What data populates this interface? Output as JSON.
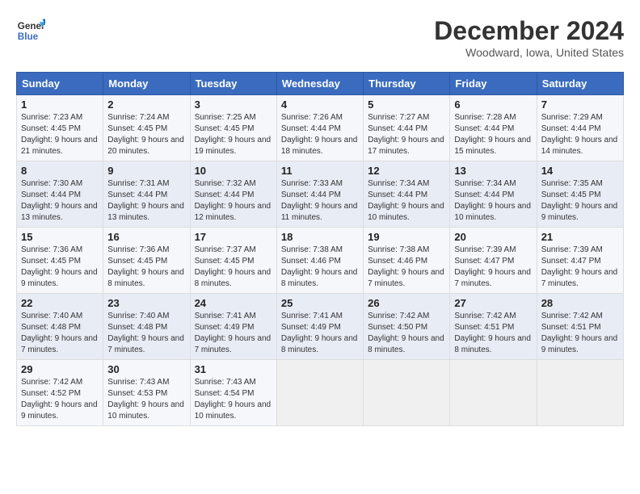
{
  "header": {
    "logo_line1": "General",
    "logo_line2": "Blue",
    "month": "December 2024",
    "location": "Woodward, Iowa, United States"
  },
  "weekdays": [
    "Sunday",
    "Monday",
    "Tuesday",
    "Wednesday",
    "Thursday",
    "Friday",
    "Saturday"
  ],
  "weeks": [
    [
      {
        "day": "1",
        "sunrise": "Sunrise: 7:23 AM",
        "sunset": "Sunset: 4:45 PM",
        "daylight": "Daylight: 9 hours and 21 minutes."
      },
      {
        "day": "2",
        "sunrise": "Sunrise: 7:24 AM",
        "sunset": "Sunset: 4:45 PM",
        "daylight": "Daylight: 9 hours and 20 minutes."
      },
      {
        "day": "3",
        "sunrise": "Sunrise: 7:25 AM",
        "sunset": "Sunset: 4:45 PM",
        "daylight": "Daylight: 9 hours and 19 minutes."
      },
      {
        "day": "4",
        "sunrise": "Sunrise: 7:26 AM",
        "sunset": "Sunset: 4:44 PM",
        "daylight": "Daylight: 9 hours and 18 minutes."
      },
      {
        "day": "5",
        "sunrise": "Sunrise: 7:27 AM",
        "sunset": "Sunset: 4:44 PM",
        "daylight": "Daylight: 9 hours and 17 minutes."
      },
      {
        "day": "6",
        "sunrise": "Sunrise: 7:28 AM",
        "sunset": "Sunset: 4:44 PM",
        "daylight": "Daylight: 9 hours and 15 minutes."
      },
      {
        "day": "7",
        "sunrise": "Sunrise: 7:29 AM",
        "sunset": "Sunset: 4:44 PM",
        "daylight": "Daylight: 9 hours and 14 minutes."
      }
    ],
    [
      {
        "day": "8",
        "sunrise": "Sunrise: 7:30 AM",
        "sunset": "Sunset: 4:44 PM",
        "daylight": "Daylight: 9 hours and 13 minutes."
      },
      {
        "day": "9",
        "sunrise": "Sunrise: 7:31 AM",
        "sunset": "Sunset: 4:44 PM",
        "daylight": "Daylight: 9 hours and 13 minutes."
      },
      {
        "day": "10",
        "sunrise": "Sunrise: 7:32 AM",
        "sunset": "Sunset: 4:44 PM",
        "daylight": "Daylight: 9 hours and 12 minutes."
      },
      {
        "day": "11",
        "sunrise": "Sunrise: 7:33 AM",
        "sunset": "Sunset: 4:44 PM",
        "daylight": "Daylight: 9 hours and 11 minutes."
      },
      {
        "day": "12",
        "sunrise": "Sunrise: 7:34 AM",
        "sunset": "Sunset: 4:44 PM",
        "daylight": "Daylight: 9 hours and 10 minutes."
      },
      {
        "day": "13",
        "sunrise": "Sunrise: 7:34 AM",
        "sunset": "Sunset: 4:44 PM",
        "daylight": "Daylight: 9 hours and 10 minutes."
      },
      {
        "day": "14",
        "sunrise": "Sunrise: 7:35 AM",
        "sunset": "Sunset: 4:45 PM",
        "daylight": "Daylight: 9 hours and 9 minutes."
      }
    ],
    [
      {
        "day": "15",
        "sunrise": "Sunrise: 7:36 AM",
        "sunset": "Sunset: 4:45 PM",
        "daylight": "Daylight: 9 hours and 9 minutes."
      },
      {
        "day": "16",
        "sunrise": "Sunrise: 7:36 AM",
        "sunset": "Sunset: 4:45 PM",
        "daylight": "Daylight: 9 hours and 8 minutes."
      },
      {
        "day": "17",
        "sunrise": "Sunrise: 7:37 AM",
        "sunset": "Sunset: 4:45 PM",
        "daylight": "Daylight: 9 hours and 8 minutes."
      },
      {
        "day": "18",
        "sunrise": "Sunrise: 7:38 AM",
        "sunset": "Sunset: 4:46 PM",
        "daylight": "Daylight: 9 hours and 8 minutes."
      },
      {
        "day": "19",
        "sunrise": "Sunrise: 7:38 AM",
        "sunset": "Sunset: 4:46 PM",
        "daylight": "Daylight: 9 hours and 7 minutes."
      },
      {
        "day": "20",
        "sunrise": "Sunrise: 7:39 AM",
        "sunset": "Sunset: 4:47 PM",
        "daylight": "Daylight: 9 hours and 7 minutes."
      },
      {
        "day": "21",
        "sunrise": "Sunrise: 7:39 AM",
        "sunset": "Sunset: 4:47 PM",
        "daylight": "Daylight: 9 hours and 7 minutes."
      }
    ],
    [
      {
        "day": "22",
        "sunrise": "Sunrise: 7:40 AM",
        "sunset": "Sunset: 4:48 PM",
        "daylight": "Daylight: 9 hours and 7 minutes."
      },
      {
        "day": "23",
        "sunrise": "Sunrise: 7:40 AM",
        "sunset": "Sunset: 4:48 PM",
        "daylight": "Daylight: 9 hours and 7 minutes."
      },
      {
        "day": "24",
        "sunrise": "Sunrise: 7:41 AM",
        "sunset": "Sunset: 4:49 PM",
        "daylight": "Daylight: 9 hours and 7 minutes."
      },
      {
        "day": "25",
        "sunrise": "Sunrise: 7:41 AM",
        "sunset": "Sunset: 4:49 PM",
        "daylight": "Daylight: 9 hours and 8 minutes."
      },
      {
        "day": "26",
        "sunrise": "Sunrise: 7:42 AM",
        "sunset": "Sunset: 4:50 PM",
        "daylight": "Daylight: 9 hours and 8 minutes."
      },
      {
        "day": "27",
        "sunrise": "Sunrise: 7:42 AM",
        "sunset": "Sunset: 4:51 PM",
        "daylight": "Daylight: 9 hours and 8 minutes."
      },
      {
        "day": "28",
        "sunrise": "Sunrise: 7:42 AM",
        "sunset": "Sunset: 4:51 PM",
        "daylight": "Daylight: 9 hours and 9 minutes."
      }
    ],
    [
      {
        "day": "29",
        "sunrise": "Sunrise: 7:42 AM",
        "sunset": "Sunset: 4:52 PM",
        "daylight": "Daylight: 9 hours and 9 minutes."
      },
      {
        "day": "30",
        "sunrise": "Sunrise: 7:43 AM",
        "sunset": "Sunset: 4:53 PM",
        "daylight": "Daylight: 9 hours and 10 minutes."
      },
      {
        "day": "31",
        "sunrise": "Sunrise: 7:43 AM",
        "sunset": "Sunset: 4:54 PM",
        "daylight": "Daylight: 9 hours and 10 minutes."
      },
      null,
      null,
      null,
      null
    ]
  ]
}
